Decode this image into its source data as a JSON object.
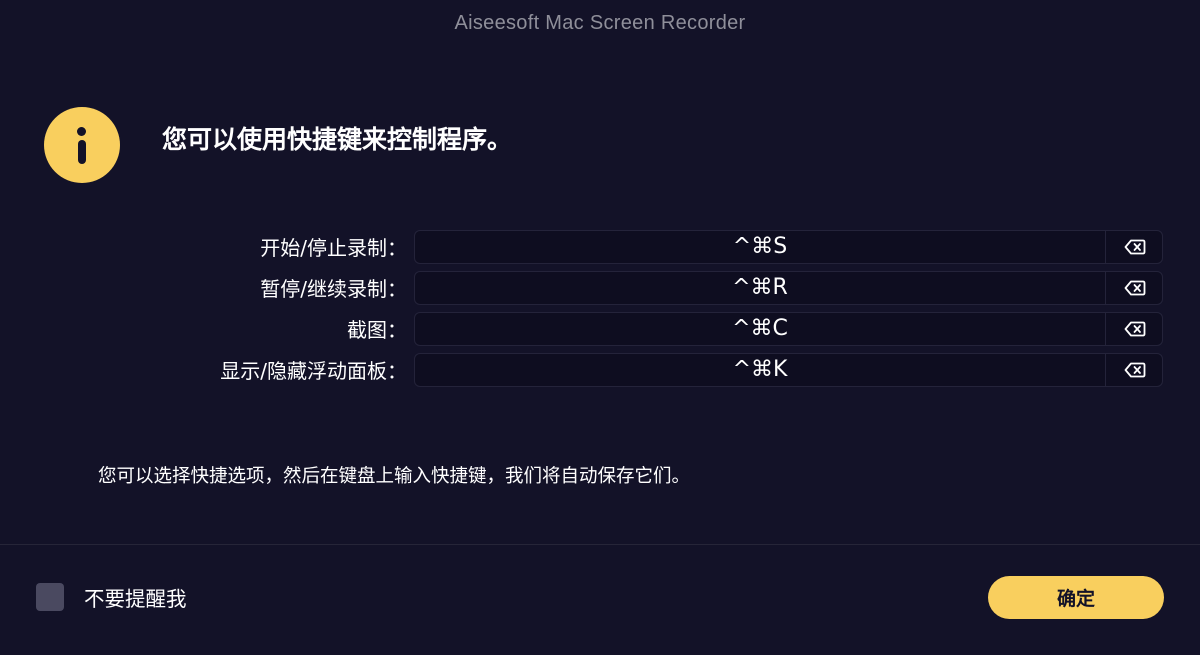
{
  "window": {
    "title": "Aiseesoft Mac Screen Recorder"
  },
  "dialog": {
    "icon": "info-icon",
    "headline": "您可以使用快捷键来控制程序。",
    "hint": "您可以选择快捷选项，然后在键盘上输入快捷键，我们将自动保存它们。"
  },
  "shortcuts": [
    {
      "label": "开始/停止录制：",
      "keys": "^⌘S",
      "clear_icon": "delete-left-icon"
    },
    {
      "label": "暂停/继续录制：",
      "keys": "^⌘R",
      "clear_icon": "delete-left-icon"
    },
    {
      "label": "截图：",
      "keys": "^⌘C",
      "clear_icon": "delete-left-icon"
    },
    {
      "label": "显示/隐藏浮动面板：",
      "keys": "^⌘K",
      "clear_icon": "delete-left-icon"
    }
  ],
  "footer": {
    "dont_remind_label": "不要提醒我",
    "dont_remind_checked": false,
    "ok_label": "确定"
  },
  "colors": {
    "background": "#131228",
    "accent": "#f9cf5e",
    "field_background": "#0e0d20",
    "checkbox": "#4a4960"
  }
}
